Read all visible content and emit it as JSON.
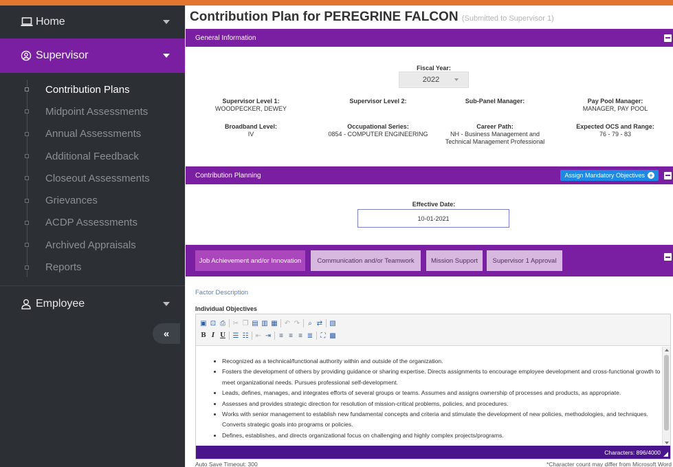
{
  "sidebar": {
    "home_label": "Home",
    "supervisor_label": "Supervisor",
    "employee_label": "Employee",
    "items": [
      {
        "label": "Contribution Plans"
      },
      {
        "label": "Midpoint Assessments"
      },
      {
        "label": "Annual Assessments"
      },
      {
        "label": "Additional Feedback"
      },
      {
        "label": "Closeout Assessments"
      },
      {
        "label": "Grievances"
      },
      {
        "label": "ACDP Assessments"
      },
      {
        "label": "Archived Appraisals"
      },
      {
        "label": "Reports"
      }
    ],
    "collapse_glyph": "«"
  },
  "page": {
    "title": "Contribution Plan for PEREGRINE FALCON",
    "status": "(Submitted to Supervisor 1)"
  },
  "general": {
    "header": "General Information",
    "fiscal_year_label": "Fiscal Year:",
    "fiscal_year_value": "2022",
    "sup1_label": "Supervisor Level 1:",
    "sup1_value": "WOODPECKER, DEWEY",
    "sup2_label": "Supervisor Level 2:",
    "subpanel_label": "Sub-Panel Manager:",
    "paypool_label": "Pay Pool Manager:",
    "paypool_value": "MANAGER, PAY POOL",
    "broadband_label": "Broadband Level:",
    "broadband_value": "IV",
    "occ_label": "Occupational Series:",
    "occ_value": "0854 - COMPUTER ENGINEERING",
    "career_label": "Career Path:",
    "career_value_1": "NH - Business Management and",
    "career_value_2": "Technical Management Professional",
    "ocs_label": "Expected OCS and Range:",
    "ocs_value": "76 - 79 - 83"
  },
  "planning": {
    "header": "Contribution Planning",
    "assign_label": "Assign Mandatory Objectives",
    "effective_label": "Effective Date:",
    "effective_value": "10-01-2021"
  },
  "tabs": [
    {
      "label": "Job Achievement and/or Innovation"
    },
    {
      "label": "Communication and/or Teamwork"
    },
    {
      "label": "Mission Support"
    },
    {
      "label": "Supervisor 1 Approval"
    }
  ],
  "factor_link": "Factor Description",
  "objectives_label": "Individual Objectives",
  "objectives": [
    "Recognized as a technical/functional authority within and outside of the organization.",
    "Fosters the development of others by providing guidance or sharing expertise. Directs assignments to encourage employee development and cross-functional growth to meet organizational needs. Pursues professional self-development.",
    "Leads, defines, manages, and integrates efforts of several groups or teams. Assumes and assigns ownership of processes and products, as appropriate.",
    "Assesses and provides strategic direction for resolution of mission-critical problems, policies, and procedures.",
    "Works with senior management to establish new fundamental concepts and criteria and stimulate the development of new policies, methodologies, and techniques. Converts strategic goals into programs or policies.",
    "Defines, establishes, and directs organizational focus on challenging and highly complex projects/programs."
  ],
  "editor": {
    "char_count": "Characters: 896/4000"
  },
  "footer": {
    "autosave": "Auto Save Timeout: 300",
    "note": "*Character count may differ from Microsoft Word"
  },
  "colors": {
    "purple": "#7b1fa2",
    "dark_purple": "#4a148c",
    "accent_orange": "#e2762f",
    "sidebar_bg": "#2c3035",
    "blue_button": "#1e88e5"
  }
}
